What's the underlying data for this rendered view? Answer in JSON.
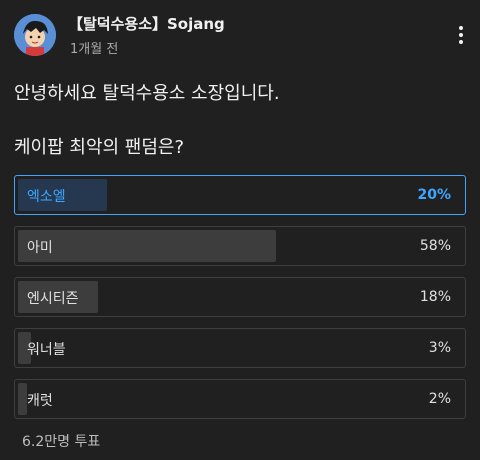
{
  "post": {
    "channel_name": "【탈덕수용소】Sojang",
    "time": "1개월 전",
    "text_line1": "안녕하세요 탈덕수용소 소장입니다.",
    "text_line2": "케이팝 최악의 팬덤은?"
  },
  "poll": {
    "options": [
      {
        "label": "엑소엘",
        "percent_text": "20%",
        "percent": 20,
        "selected": true
      },
      {
        "label": "아미",
        "percent_text": "58%",
        "percent": 58,
        "selected": false
      },
      {
        "label": "엔시티즌",
        "percent_text": "18%",
        "percent": 18,
        "selected": false
      },
      {
        "label": "워너블",
        "percent_text": "3%",
        "percent": 3,
        "selected": false
      },
      {
        "label": "캐럿",
        "percent_text": "2%",
        "percent": 2,
        "selected": false
      }
    ],
    "vote_count": "6.2만명 투표"
  },
  "icons": {
    "avatar": "cartoon-avatar",
    "more": "more-vertical-icon"
  },
  "colors": {
    "background": "#202020",
    "accent": "#3ea6ff",
    "fill": "#3d3d3d",
    "selected_fill": "#263850"
  }
}
